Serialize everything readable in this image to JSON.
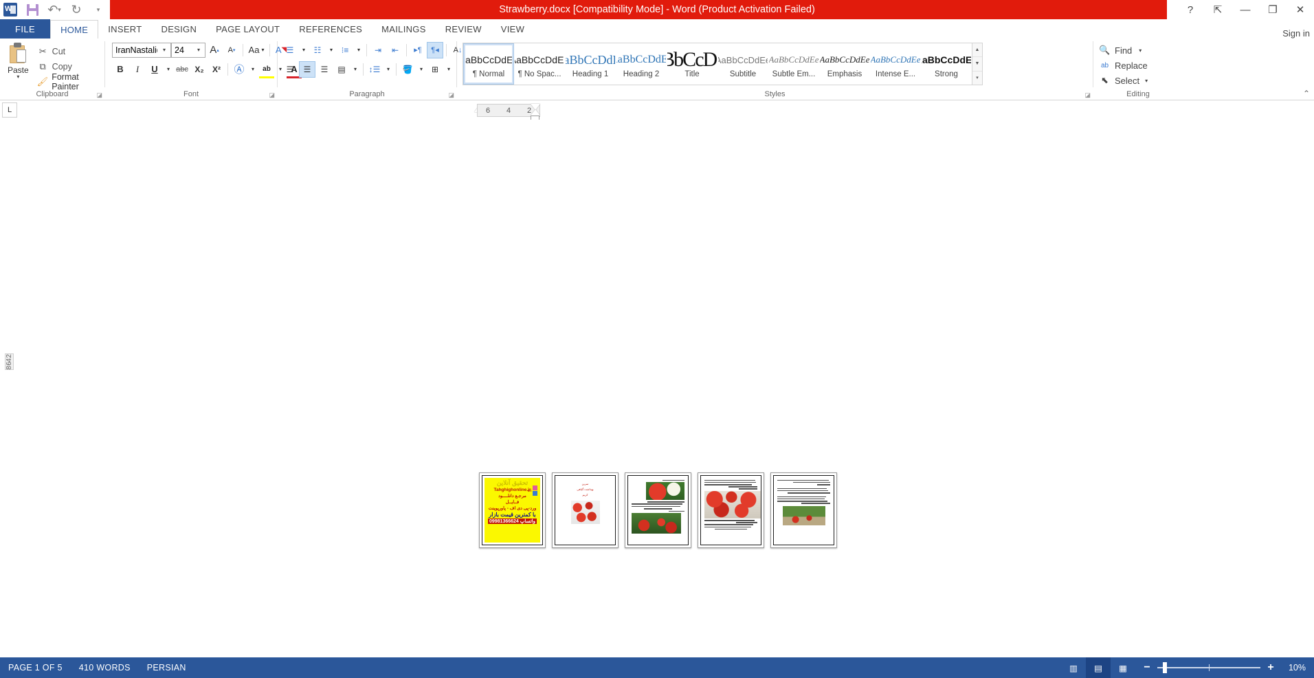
{
  "titlebar": {
    "document_title": "Strawberry.docx [Compatibility Mode]  -  Word (Product Activation Failed)",
    "quick_access": [
      {
        "name": "word-logo-icon",
        "label": "W"
      },
      {
        "name": "save-icon",
        "label": ""
      },
      {
        "name": "undo-icon",
        "label": "↶"
      },
      {
        "name": "redo-icon",
        "label": "↻"
      },
      {
        "name": "customize-qat-icon",
        "label": "▾"
      }
    ],
    "window_controls": {
      "help": "?",
      "ribbon_display": "⇱",
      "minimize": "—",
      "restore": "❐",
      "close": "✕"
    }
  },
  "tabs": {
    "file": "FILE",
    "items": [
      "HOME",
      "INSERT",
      "DESIGN",
      "PAGE LAYOUT",
      "REFERENCES",
      "MAILINGS",
      "REVIEW",
      "VIEW"
    ],
    "active": "HOME",
    "signin": "Sign in"
  },
  "ribbon": {
    "groups": {
      "clipboard": {
        "label": "Clipboard",
        "paste": "Paste",
        "cut": "Cut",
        "copy": "Copy",
        "format_painter": "Format Painter"
      },
      "font": {
        "label": "Font",
        "font_name": "IranNastaliq",
        "font_size": "24",
        "grow": "A",
        "shrink": "A",
        "change_case": "Aa",
        "clear_formatting": "A",
        "bold": "B",
        "italic": "I",
        "underline": "U",
        "strikethrough": "abc",
        "subscript": "X₂",
        "superscript": "X²",
        "text_effects": "A",
        "highlight_color": "ab",
        "font_color": "A",
        "highlight_hex": "#ffff00",
        "font_color_hex": "#d8232a"
      },
      "paragraph": {
        "label": "Paragraph",
        "bullets": "•",
        "numbering": "1",
        "multilevel": "1",
        "decrease_indent": "◄",
        "increase_indent": "►",
        "ltr_text": "▶¶",
        "rtl_text": "¶◀",
        "sort": "A↓",
        "show_marks": "¶",
        "align_left": "≡",
        "align_center": "≡",
        "align_right": "≡",
        "justify": "≡",
        "line_spacing": "↕",
        "shading": "▭",
        "borders": "⊞",
        "active_alignment": "center",
        "active_direction": "rtl"
      },
      "styles": {
        "label": "Styles",
        "items": [
          {
            "preview": "AaBbCcDdEe",
            "name": "¶ Normal",
            "selected": true,
            "style": "normal"
          },
          {
            "preview": "AaBbCcDdEe",
            "name": "¶ No Spac...",
            "selected": false,
            "style": "normal"
          },
          {
            "preview": "AaBbCcDdEe",
            "name": "Heading 1",
            "selected": false,
            "style": "h1"
          },
          {
            "preview": "AaBbCcDdEe",
            "name": "Heading 2",
            "selected": false,
            "style": "h2"
          },
          {
            "preview": "AaBbCcDdEe",
            "name": "Title",
            "selected": false,
            "style": "title"
          },
          {
            "preview": "AaBbCcDdEe",
            "name": "Subtitle",
            "selected": false,
            "style": "subtitle"
          },
          {
            "preview": "AaBbCcDdEe",
            "name": "Subtle Em...",
            "selected": false,
            "style": "subtleem"
          },
          {
            "preview": "AaBbCcDdEe",
            "name": "Emphasis",
            "selected": false,
            "style": "emphasis"
          },
          {
            "preview": "AaBbCcDdEe",
            "name": "Intense E...",
            "selected": false,
            "style": "intense"
          },
          {
            "preview": "AaBbCcDdEe",
            "name": "Strong",
            "selected": false,
            "style": "strong"
          }
        ]
      },
      "editing": {
        "label": "Editing",
        "find": "Find",
        "replace": "Replace",
        "select": "Select"
      }
    },
    "collapse": "⌃"
  },
  "ruler": {
    "tab_selector": "L",
    "horizontal_marks": [
      "6",
      "4",
      "2"
    ]
  },
  "document": {
    "pages": [
      {
        "n": 1,
        "kind": "cover-advert",
        "advert": {
          "title": "تحقیق آنلاین",
          "url": "Tahghighonline.ir",
          "line1": "مرجـع دانلــــود",
          "line2": "فــایــل",
          "line3": "ورد-پی دی اف - پاورپوینت",
          "line4": "با کمترین قیمت بازار",
          "phone": "09981366624 واتساپ"
        }
      },
      {
        "n": 2,
        "kind": "title-page",
        "headings": [
          "تمرین",
          "بهداشت گیاهی",
          "کریم"
        ]
      },
      {
        "n": 3,
        "kind": "text-images"
      },
      {
        "n": 4,
        "kind": "text-images"
      },
      {
        "n": 5,
        "kind": "text-images"
      }
    ]
  },
  "status": {
    "page": "PAGE 1 OF 5",
    "words": "410 WORDS",
    "language": "PERSIAN",
    "views": [
      {
        "name": "read-mode-view",
        "glyph": "▥",
        "active": false
      },
      {
        "name": "print-layout-view",
        "glyph": "▤",
        "active": true
      },
      {
        "name": "web-layout-view",
        "glyph": "▦",
        "active": false
      }
    ],
    "zoom_out": "−",
    "zoom_in": "+",
    "zoom_value": "10%"
  }
}
